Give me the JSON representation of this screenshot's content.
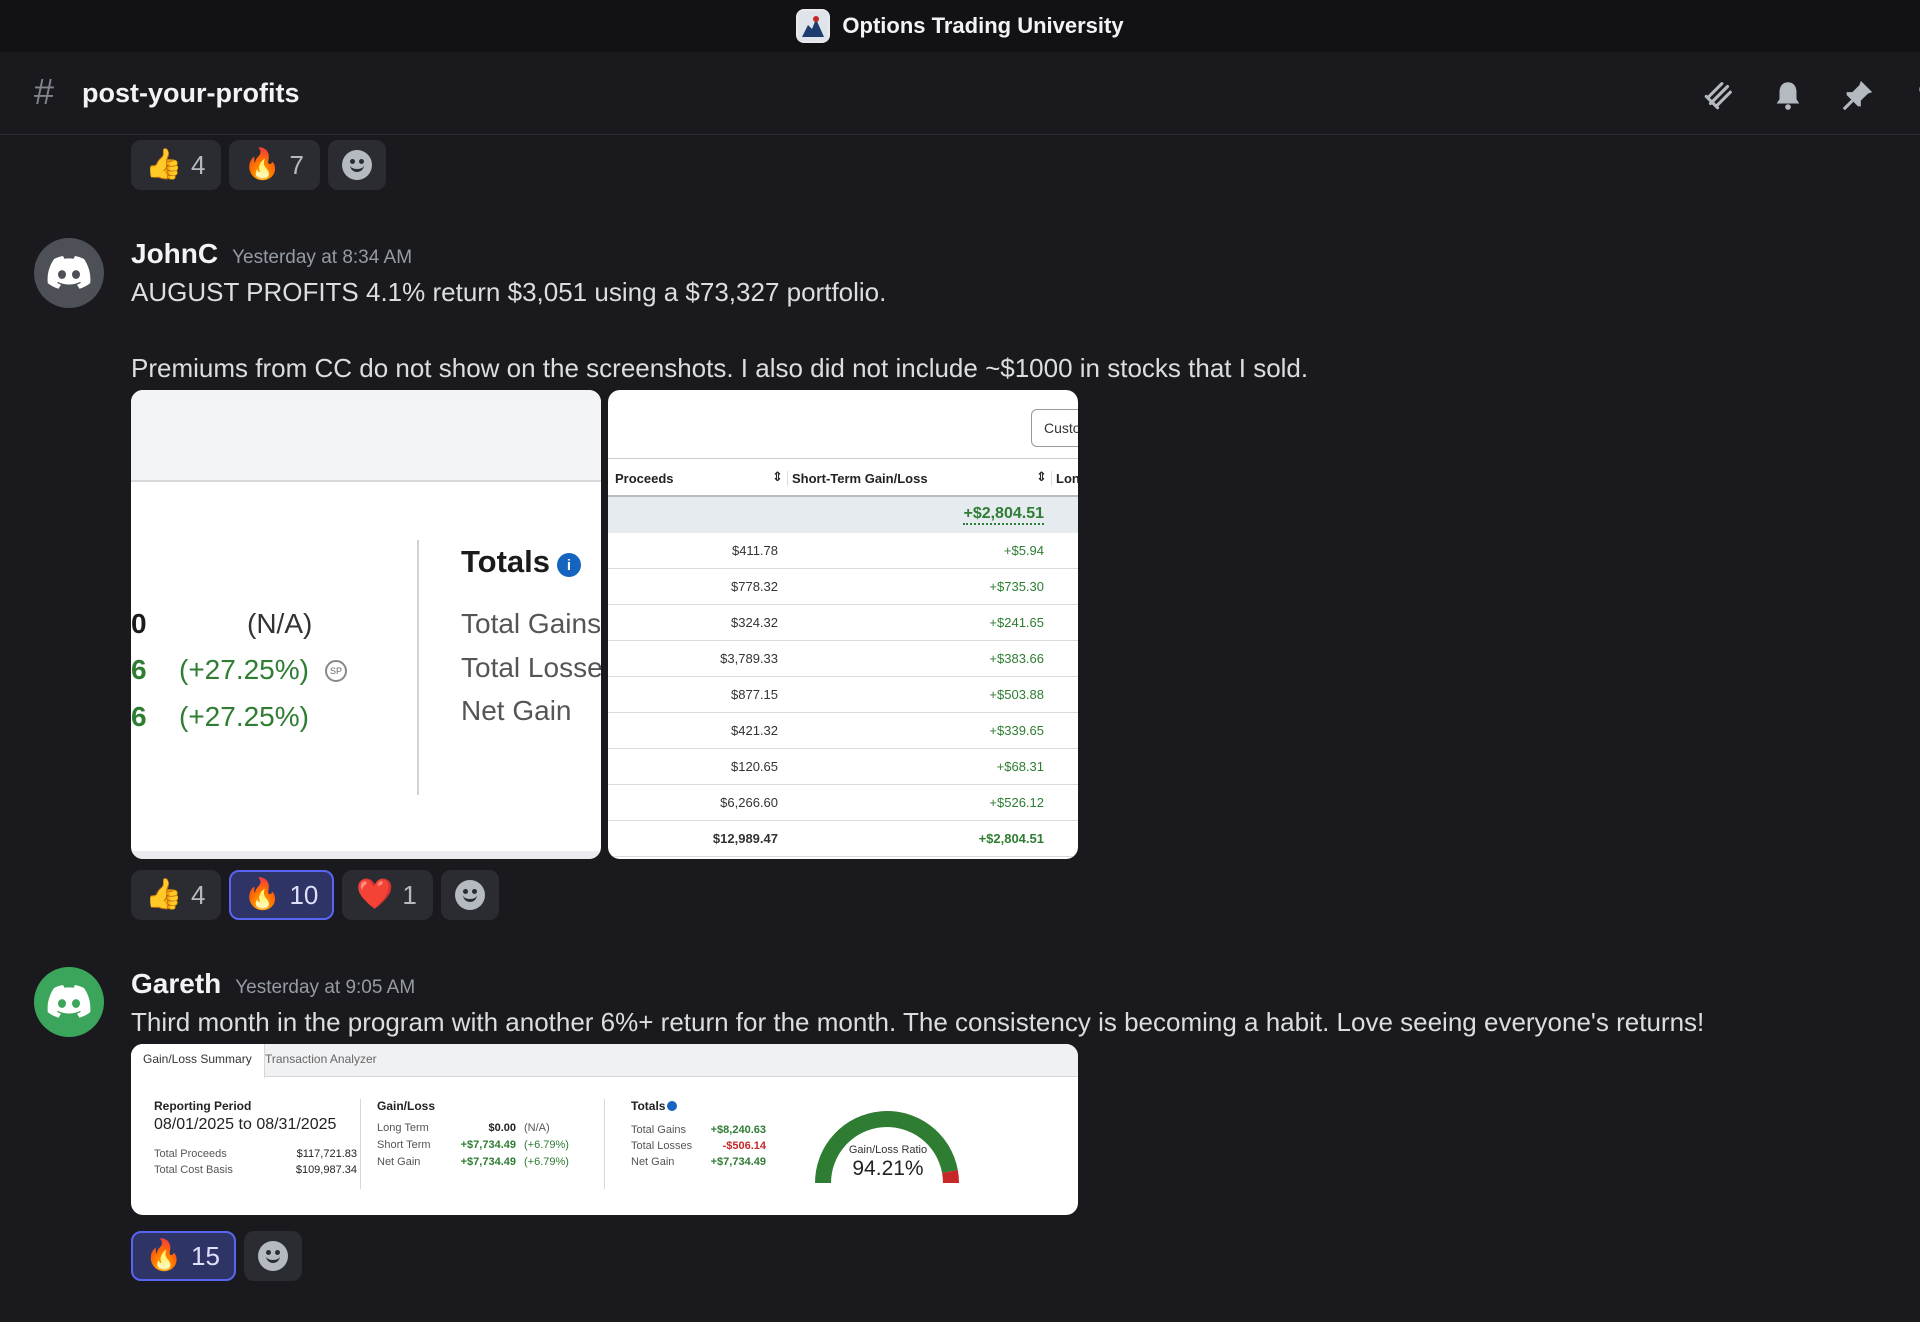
{
  "window": {
    "title": "Options Trading University"
  },
  "channel": {
    "name": "post-your-profits"
  },
  "top_reactions": [
    {
      "emoji": "👍",
      "count": "4"
    },
    {
      "emoji": "🔥",
      "count": "7"
    }
  ],
  "messages": [
    {
      "author": "JohnC",
      "timestamp": "Yesterday at 8:34 AM",
      "line1": "AUGUST PROFITS 4.1% return $3,051 using a $73,327 portfolio.",
      "line2": "Premiums from CC do not show on the screenshots. I also did not include ~$1000 in stocks that I sold.",
      "reactions": [
        {
          "emoji": "👍",
          "count": "4"
        },
        {
          "emoji": "🔥",
          "count": "10"
        },
        {
          "emoji": "❤️",
          "count": "1"
        }
      ]
    },
    {
      "author": "Gareth",
      "timestamp": "Yesterday at 9:05 AM",
      "line1": "Third month in the program with another 6%+ return for the month. The consistency is becoming a habit. Love seeing everyone's returns!",
      "reactions": [
        {
          "emoji": "🔥",
          "count": "15"
        }
      ]
    }
  ],
  "image1": {
    "col_values": [
      "0",
      "6",
      "6"
    ],
    "pct_values": [
      "(N/A)",
      "(+27.25%)",
      "(+27.25%)"
    ],
    "sp_badge": "SP",
    "totals_title": "Totals",
    "info_glyph": "i",
    "labels": [
      "Total Gains",
      "Total Losse",
      "Net Gain"
    ]
  },
  "image2": {
    "button": "Custo",
    "headers": {
      "proceeds": "Proceeds",
      "short_term": "Short-Term Gain/Loss",
      "long": "Long"
    },
    "summary_total": "+$2,804.51",
    "rows": [
      {
        "proceeds": "$411.78",
        "gain": "+$5.94"
      },
      {
        "proceeds": "$778.32",
        "gain": "+$735.30"
      },
      {
        "proceeds": "$324.32",
        "gain": "+$241.65"
      },
      {
        "proceeds": "$3,789.33",
        "gain": "+$383.66"
      },
      {
        "proceeds": "$877.15",
        "gain": "+$503.88"
      },
      {
        "proceeds": "$421.32",
        "gain": "+$339.65"
      },
      {
        "proceeds": "$120.65",
        "gain": "+$68.31"
      },
      {
        "proceeds": "$6,266.60",
        "gain": "+$526.12"
      }
    ],
    "total_row": {
      "proceeds": "$12,989.47",
      "gain": "+$2,804.51"
    }
  },
  "image3": {
    "tabs": [
      "Gain/Loss Summary",
      "Transaction Analyzer"
    ],
    "reporting_label": "Reporting Period",
    "reporting_value": "08/01/2025 to 08/31/2025",
    "total_proceeds_label": "Total Proceeds",
    "total_proceeds": "$117,721.83",
    "total_cost_label": "Total Cost Basis",
    "total_cost": "$109,987.34",
    "gainloss_title": "Gain/Loss",
    "long_term_label": "Long Term",
    "long_term": "$0.00",
    "long_term_pct": "(N/A)",
    "short_term_label": "Short Term",
    "short_term": "+$7,734.49",
    "short_term_pct": "(+6.79%)",
    "net_gain_label": "Net Gain",
    "net_gain": "+$7,734.49",
    "net_gain_pct": "(+6.79%)",
    "totals_title": "Totals",
    "total_gains_label": "Total Gains",
    "total_gains": "+$8,240.63",
    "total_losses_label": "Total Losses",
    "total_losses": "-$506.14",
    "net_gain2_label": "Net Gain",
    "net_gain2": "+$7,734.49",
    "ratio_label": "Gain/Loss Ratio",
    "ratio_value": "94.21%",
    "ratio_fraction": 0.9421,
    "colors": {
      "gain": "#2e7d32",
      "loss": "#c62828"
    }
  }
}
